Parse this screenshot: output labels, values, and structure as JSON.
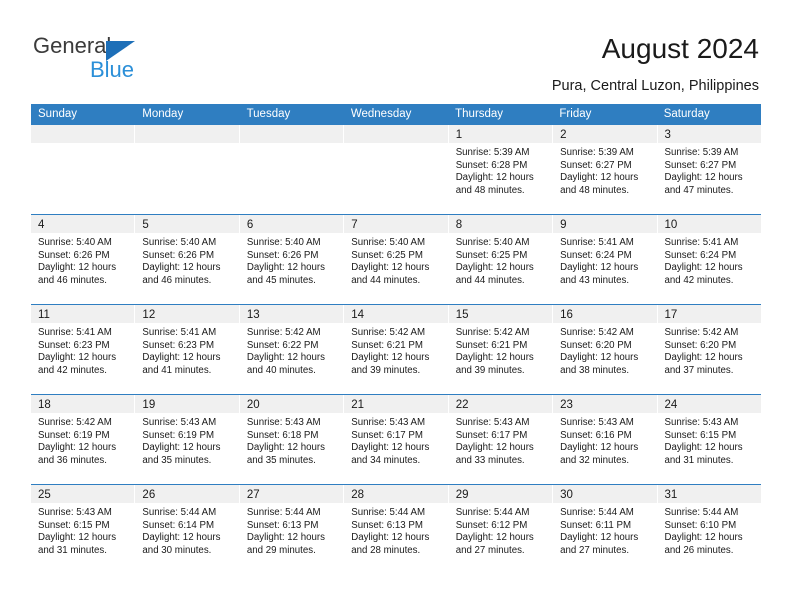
{
  "brand": {
    "word_one": "General",
    "word_two": "Blue",
    "triangle_color": "#1d6fb8",
    "blue_text_color": "#2b8fd8"
  },
  "header": {
    "title": "August 2024",
    "subtitle": "Pura, Central Luzon, Philippines",
    "header_bg": "#2f7ec1",
    "daynum_band_bg": "#f0f0f0"
  },
  "weekday_names": [
    "Sunday",
    "Monday",
    "Tuesday",
    "Wednesday",
    "Thursday",
    "Friday",
    "Saturday"
  ],
  "labels": {
    "sunrise_prefix": "Sunrise:",
    "sunset_prefix": "Sunset:",
    "daylight_prefix": "Daylight:"
  },
  "weeks": [
    [
      {
        "day": "",
        "empty": true
      },
      {
        "day": "",
        "empty": true
      },
      {
        "day": "",
        "empty": true
      },
      {
        "day": "",
        "empty": true
      },
      {
        "day": "1",
        "sunrise": "Sunrise: 5:39 AM",
        "sunset": "Sunset: 6:28 PM",
        "daylight1": "Daylight: 12 hours",
        "daylight2": "and 48 minutes."
      },
      {
        "day": "2",
        "sunrise": "Sunrise: 5:39 AM",
        "sunset": "Sunset: 6:27 PM",
        "daylight1": "Daylight: 12 hours",
        "daylight2": "and 48 minutes."
      },
      {
        "day": "3",
        "sunrise": "Sunrise: 5:39 AM",
        "sunset": "Sunset: 6:27 PM",
        "daylight1": "Daylight: 12 hours",
        "daylight2": "and 47 minutes."
      }
    ],
    [
      {
        "day": "4",
        "sunrise": "Sunrise: 5:40 AM",
        "sunset": "Sunset: 6:26 PM",
        "daylight1": "Daylight: 12 hours",
        "daylight2": "and 46 minutes."
      },
      {
        "day": "5",
        "sunrise": "Sunrise: 5:40 AM",
        "sunset": "Sunset: 6:26 PM",
        "daylight1": "Daylight: 12 hours",
        "daylight2": "and 46 minutes."
      },
      {
        "day": "6",
        "sunrise": "Sunrise: 5:40 AM",
        "sunset": "Sunset: 6:26 PM",
        "daylight1": "Daylight: 12 hours",
        "daylight2": "and 45 minutes."
      },
      {
        "day": "7",
        "sunrise": "Sunrise: 5:40 AM",
        "sunset": "Sunset: 6:25 PM",
        "daylight1": "Daylight: 12 hours",
        "daylight2": "and 44 minutes."
      },
      {
        "day": "8",
        "sunrise": "Sunrise: 5:40 AM",
        "sunset": "Sunset: 6:25 PM",
        "daylight1": "Daylight: 12 hours",
        "daylight2": "and 44 minutes."
      },
      {
        "day": "9",
        "sunrise": "Sunrise: 5:41 AM",
        "sunset": "Sunset: 6:24 PM",
        "daylight1": "Daylight: 12 hours",
        "daylight2": "and 43 minutes."
      },
      {
        "day": "10",
        "sunrise": "Sunrise: 5:41 AM",
        "sunset": "Sunset: 6:24 PM",
        "daylight1": "Daylight: 12 hours",
        "daylight2": "and 42 minutes."
      }
    ],
    [
      {
        "day": "11",
        "sunrise": "Sunrise: 5:41 AM",
        "sunset": "Sunset: 6:23 PM",
        "daylight1": "Daylight: 12 hours",
        "daylight2": "and 42 minutes."
      },
      {
        "day": "12",
        "sunrise": "Sunrise: 5:41 AM",
        "sunset": "Sunset: 6:23 PM",
        "daylight1": "Daylight: 12 hours",
        "daylight2": "and 41 minutes."
      },
      {
        "day": "13",
        "sunrise": "Sunrise: 5:42 AM",
        "sunset": "Sunset: 6:22 PM",
        "daylight1": "Daylight: 12 hours",
        "daylight2": "and 40 minutes."
      },
      {
        "day": "14",
        "sunrise": "Sunrise: 5:42 AM",
        "sunset": "Sunset: 6:21 PM",
        "daylight1": "Daylight: 12 hours",
        "daylight2": "and 39 minutes."
      },
      {
        "day": "15",
        "sunrise": "Sunrise: 5:42 AM",
        "sunset": "Sunset: 6:21 PM",
        "daylight1": "Daylight: 12 hours",
        "daylight2": "and 39 minutes."
      },
      {
        "day": "16",
        "sunrise": "Sunrise: 5:42 AM",
        "sunset": "Sunset: 6:20 PM",
        "daylight1": "Daylight: 12 hours",
        "daylight2": "and 38 minutes."
      },
      {
        "day": "17",
        "sunrise": "Sunrise: 5:42 AM",
        "sunset": "Sunset: 6:20 PM",
        "daylight1": "Daylight: 12 hours",
        "daylight2": "and 37 minutes."
      }
    ],
    [
      {
        "day": "18",
        "sunrise": "Sunrise: 5:42 AM",
        "sunset": "Sunset: 6:19 PM",
        "daylight1": "Daylight: 12 hours",
        "daylight2": "and 36 minutes."
      },
      {
        "day": "19",
        "sunrise": "Sunrise: 5:43 AM",
        "sunset": "Sunset: 6:19 PM",
        "daylight1": "Daylight: 12 hours",
        "daylight2": "and 35 minutes."
      },
      {
        "day": "20",
        "sunrise": "Sunrise: 5:43 AM",
        "sunset": "Sunset: 6:18 PM",
        "daylight1": "Daylight: 12 hours",
        "daylight2": "and 35 minutes."
      },
      {
        "day": "21",
        "sunrise": "Sunrise: 5:43 AM",
        "sunset": "Sunset: 6:17 PM",
        "daylight1": "Daylight: 12 hours",
        "daylight2": "and 34 minutes."
      },
      {
        "day": "22",
        "sunrise": "Sunrise: 5:43 AM",
        "sunset": "Sunset: 6:17 PM",
        "daylight1": "Daylight: 12 hours",
        "daylight2": "and 33 minutes."
      },
      {
        "day": "23",
        "sunrise": "Sunrise: 5:43 AM",
        "sunset": "Sunset: 6:16 PM",
        "daylight1": "Daylight: 12 hours",
        "daylight2": "and 32 minutes."
      },
      {
        "day": "24",
        "sunrise": "Sunrise: 5:43 AM",
        "sunset": "Sunset: 6:15 PM",
        "daylight1": "Daylight: 12 hours",
        "daylight2": "and 31 minutes."
      }
    ],
    [
      {
        "day": "25",
        "sunrise": "Sunrise: 5:43 AM",
        "sunset": "Sunset: 6:15 PM",
        "daylight1": "Daylight: 12 hours",
        "daylight2": "and 31 minutes."
      },
      {
        "day": "26",
        "sunrise": "Sunrise: 5:44 AM",
        "sunset": "Sunset: 6:14 PM",
        "daylight1": "Daylight: 12 hours",
        "daylight2": "and 30 minutes."
      },
      {
        "day": "27",
        "sunrise": "Sunrise: 5:44 AM",
        "sunset": "Sunset: 6:13 PM",
        "daylight1": "Daylight: 12 hours",
        "daylight2": "and 29 minutes."
      },
      {
        "day": "28",
        "sunrise": "Sunrise: 5:44 AM",
        "sunset": "Sunset: 6:13 PM",
        "daylight1": "Daylight: 12 hours",
        "daylight2": "and 28 minutes."
      },
      {
        "day": "29",
        "sunrise": "Sunrise: 5:44 AM",
        "sunset": "Sunset: 6:12 PM",
        "daylight1": "Daylight: 12 hours",
        "daylight2": "and 27 minutes."
      },
      {
        "day": "30",
        "sunrise": "Sunrise: 5:44 AM",
        "sunset": "Sunset: 6:11 PM",
        "daylight1": "Daylight: 12 hours",
        "daylight2": "and 27 minutes."
      },
      {
        "day": "31",
        "sunrise": "Sunrise: 5:44 AM",
        "sunset": "Sunset: 6:10 PM",
        "daylight1": "Daylight: 12 hours",
        "daylight2": "and 26 minutes."
      }
    ]
  ]
}
